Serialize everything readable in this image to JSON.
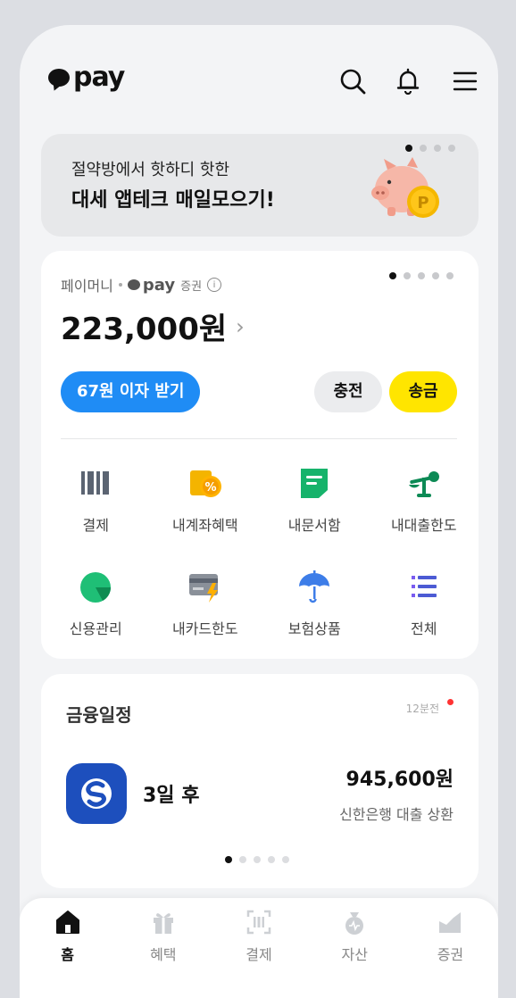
{
  "header": {
    "logo_text": "pay"
  },
  "banner": {
    "line1": "절약방에서 핫하디 핫한",
    "line2": "대세 앱테크 매일모으기!",
    "coin_letter": "P",
    "page_index": 1,
    "page_count": 4
  },
  "money": {
    "label": "페이머니",
    "brand": "pay",
    "brand_sub": "증권",
    "info_glyph": "i",
    "balance": "223,000원",
    "chevron": "›",
    "interest_button": "67원 이자 받기",
    "charge_button": "충전",
    "send_button": "송금",
    "page_index": 1,
    "page_count": 5,
    "services": [
      {
        "label": "결제",
        "icon": "barcode-icon"
      },
      {
        "label": "내계좌혜택",
        "icon": "account-benefit-icon"
      },
      {
        "label": "내문서함",
        "icon": "document-icon"
      },
      {
        "label": "내대출한도",
        "icon": "scale-icon"
      },
      {
        "label": "신용관리",
        "icon": "credit-chart-icon"
      },
      {
        "label": "내카드한도",
        "icon": "card-limit-icon"
      },
      {
        "label": "보험상품",
        "icon": "umbrella-icon"
      },
      {
        "label": "전체",
        "icon": "list-icon"
      }
    ]
  },
  "schedule": {
    "title": "금융일정",
    "updated": "12분전",
    "when": "3일 후",
    "amount": "945,600원",
    "description": "신한은행 대출 상환",
    "page_index": 1,
    "page_count": 5
  },
  "nav": [
    {
      "label": "홈",
      "icon": "home-icon",
      "active": true
    },
    {
      "label": "혜택",
      "icon": "gift-icon",
      "active": false
    },
    {
      "label": "결제",
      "icon": "scan-icon",
      "active": false
    },
    {
      "label": "자산",
      "icon": "money-bag-icon",
      "active": false
    },
    {
      "label": "증권",
      "icon": "stock-icon",
      "active": false
    }
  ],
  "colors": {
    "accent_blue": "#1f8cf5",
    "kakao_yellow": "#ffe500",
    "bank_blue": "#1d4fbd"
  }
}
